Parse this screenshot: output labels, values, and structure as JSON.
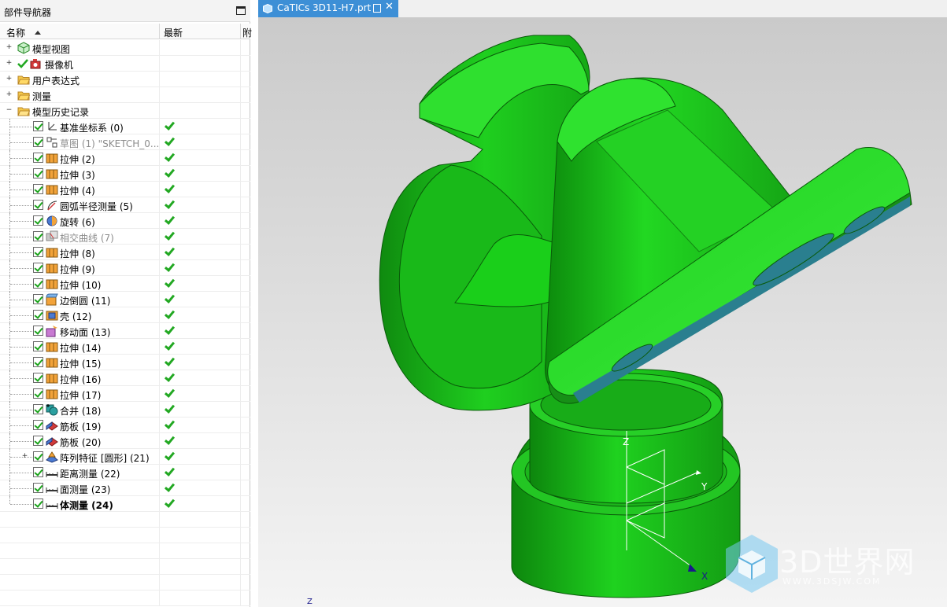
{
  "navigator": {
    "title": "部件导航器",
    "columns": {
      "name": "名称",
      "latest": "最新",
      "extra": "附"
    },
    "top_nodes": [
      {
        "label": "模型视图"
      },
      {
        "label": "摄像机"
      },
      {
        "label": "用户表达式"
      },
      {
        "label": "测量"
      },
      {
        "label": "模型历史记录"
      }
    ],
    "history": [
      {
        "label": "基准坐标系 (0)",
        "icon": "datum-csys-icon",
        "dim": false
      },
      {
        "label": "草图 (1) \"SKETCH_0...",
        "icon": "sketch-icon",
        "dim": true
      },
      {
        "label": "拉伸 (2)",
        "icon": "extrude-icon",
        "dim": false
      },
      {
        "label": "拉伸 (3)",
        "icon": "extrude-icon",
        "dim": false
      },
      {
        "label": "拉伸 (4)",
        "icon": "extrude-icon",
        "dim": false
      },
      {
        "label": "圆弧半径测量 (5)",
        "icon": "arc-radius-measure-icon",
        "dim": false
      },
      {
        "label": "旋转 (6)",
        "icon": "revolve-icon",
        "dim": false
      },
      {
        "label": "相交曲线 (7)",
        "icon": "intersection-curve-icon",
        "dim": true
      },
      {
        "label": "拉伸 (8)",
        "icon": "extrude-icon",
        "dim": false
      },
      {
        "label": "拉伸 (9)",
        "icon": "extrude-icon",
        "dim": false
      },
      {
        "label": "拉伸 (10)",
        "icon": "extrude-icon",
        "dim": false
      },
      {
        "label": "边倒圆 (11)",
        "icon": "edge-blend-icon",
        "dim": false
      },
      {
        "label": "壳 (12)",
        "icon": "shell-icon",
        "dim": false
      },
      {
        "label": "移动面 (13)",
        "icon": "move-face-icon",
        "dim": false
      },
      {
        "label": "拉伸 (14)",
        "icon": "extrude-icon",
        "dim": false
      },
      {
        "label": "拉伸 (15)",
        "icon": "extrude-icon",
        "dim": false
      },
      {
        "label": "拉伸 (16)",
        "icon": "extrude-icon",
        "dim": false
      },
      {
        "label": "拉伸 (17)",
        "icon": "extrude-icon",
        "dim": false
      },
      {
        "label": "合并 (18)",
        "icon": "unite-icon",
        "dim": false
      },
      {
        "label": "筋板 (19)",
        "icon": "rib-icon",
        "dim": false
      },
      {
        "label": "筋板 (20)",
        "icon": "rib-icon",
        "dim": false
      },
      {
        "label": "阵列特征 [圆形] (21)",
        "icon": "pattern-feature-icon",
        "dim": false
      },
      {
        "label": "距离测量 (22)",
        "icon": "distance-measure-icon",
        "dim": false
      },
      {
        "label": "面测量 (23)",
        "icon": "face-measure-icon",
        "dim": false
      },
      {
        "label": "体测量 (24)",
        "icon": "body-measure-icon",
        "dim": false
      }
    ]
  },
  "document": {
    "tab_title": "CaTICs 3D11-H7.prt"
  },
  "axes": {
    "z": "Z",
    "y": "Y",
    "x": "X",
    "corner_z": "Z"
  },
  "watermark": {
    "brand": "3D世界网",
    "url": "WWW.3DSJW.COM"
  },
  "colors": {
    "model_green": "#1fd11f",
    "model_dark_green": "#0f8f0f",
    "tab_blue": "#3d8fd6",
    "hole_teal": "#2a7f8f"
  }
}
